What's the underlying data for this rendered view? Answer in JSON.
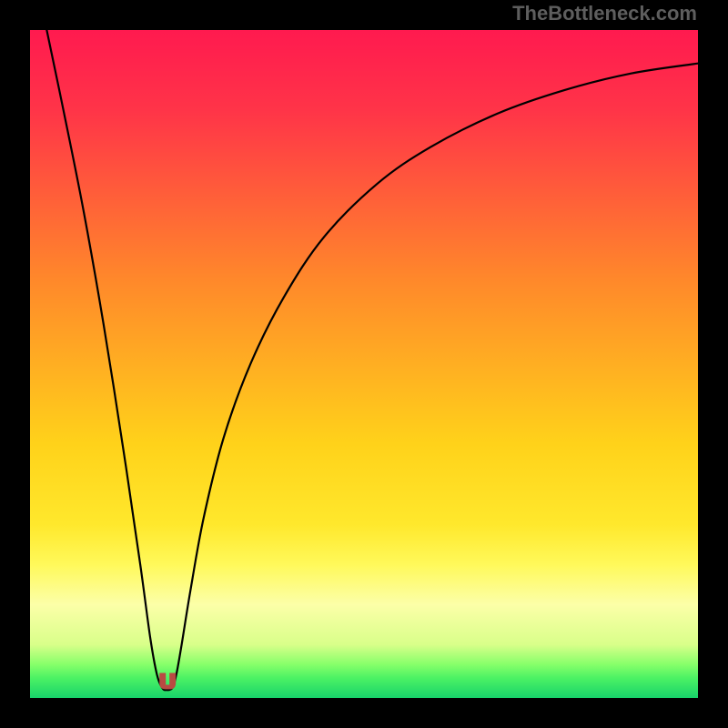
{
  "watermark": "TheBottleneck.com",
  "colors": {
    "bg": "#000000",
    "gradient_stops": [
      {
        "offset": 0.0,
        "color": "#ff1a4f"
      },
      {
        "offset": 0.12,
        "color": "#ff3448"
      },
      {
        "offset": 0.38,
        "color": "#ff8a2a"
      },
      {
        "offset": 0.62,
        "color": "#ffd21a"
      },
      {
        "offset": 0.74,
        "color": "#ffe82c"
      },
      {
        "offset": 0.8,
        "color": "#fff95a"
      },
      {
        "offset": 0.86,
        "color": "#fcffa8"
      },
      {
        "offset": 0.92,
        "color": "#d9ff8a"
      },
      {
        "offset": 0.95,
        "color": "#86ff6a"
      },
      {
        "offset": 0.97,
        "color": "#4cf264"
      },
      {
        "offset": 1.0,
        "color": "#17d36a"
      }
    ],
    "curve": "#000000",
    "marker": "#b94a42"
  },
  "chart_data": {
    "type": "line",
    "title": "",
    "xlabel": "",
    "ylabel": "",
    "xlim": [
      0,
      100
    ],
    "ylim": [
      0,
      100
    ],
    "series": [
      {
        "name": "bottleneck-curve",
        "x": [
          2.5,
          5,
          8,
          11,
          14,
          16.5,
          18,
          19,
          19.8,
          20.4,
          21.3,
          21.9,
          22.7,
          24,
          26,
          29,
          33,
          38,
          44,
          52,
          60,
          70,
          80,
          90,
          100
        ],
        "values": [
          100,
          88,
          73,
          56,
          37,
          20,
          9,
          3.5,
          1.5,
          1.2,
          1.5,
          3.5,
          8,
          16,
          27,
          39,
          50,
          60,
          69,
          77,
          82.5,
          87.5,
          91,
          93.5,
          95
        ]
      }
    ],
    "annotations": [
      {
        "name": "optimal-point",
        "x": 20.6,
        "y": 1.3
      }
    ]
  }
}
